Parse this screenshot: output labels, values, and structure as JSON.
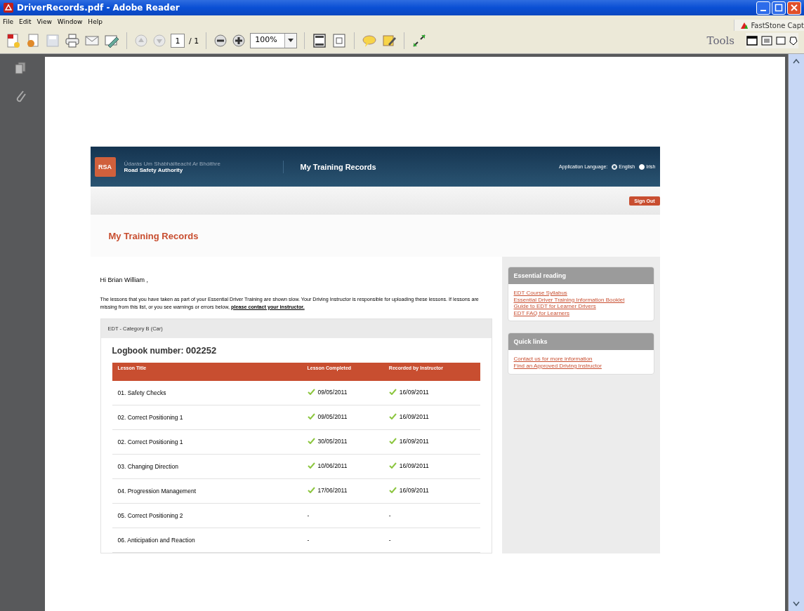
{
  "window": {
    "title": "DriverRecords.pdf - Adobe Reader"
  },
  "menu": [
    "File",
    "Edit",
    "View",
    "Window",
    "Help"
  ],
  "toolbar": {
    "page_number": "1",
    "page_total": "/ 1",
    "zoom": "100%",
    "tools": "Tools"
  },
  "capture_bar": {
    "title": "FastStone Capt"
  },
  "site": {
    "logo": "RSA",
    "org_irish": "Údarás Um Shábháilteacht Ar Bhóithre",
    "org_english": "Road Safety Authority",
    "header_title": "My Training Records",
    "language_label": "Application Language:",
    "languages": [
      {
        "label": "English",
        "selected": true
      },
      {
        "label": "Irish",
        "selected": false
      }
    ],
    "sign_out": "Sign Out",
    "page_title": "My Training Records"
  },
  "greeting": "Hi Brian William ,",
  "intro": "The lessons that you have taken as part of your Essential Driver Training are shown slow. Your Driving Instructor is responsible for uploading these lessons. If lessons are missing from this list, or you see warnings or errors below,",
  "intro_link": "please contact your instructor.",
  "category": "EDT - Category B (Car)",
  "logbook_label": "Logbook number:",
  "logbook_number": "002252",
  "table": {
    "columns": [
      "Lesson Title",
      "Lesson Completed",
      "Recorded by Instructor"
    ],
    "rows": [
      {
        "title": "01. Safety Checks",
        "completed": "09/05/2011",
        "recorded": "16/09/2011",
        "done": true
      },
      {
        "title": "02. Correct Positioning 1",
        "completed": "09/05/2011",
        "recorded": "16/09/2011",
        "done": true
      },
      {
        "title": "02. Correct Positioning 1",
        "completed": "30/05/2011",
        "recorded": "16/09/2011",
        "done": true
      },
      {
        "title": "03. Changing Direction",
        "completed": "10/06/2011",
        "recorded": "16/09/2011",
        "done": true
      },
      {
        "title": "04. Progression Management",
        "completed": "17/06/2011",
        "recorded": "16/09/2011",
        "done": true
      },
      {
        "title": "05. Correct Positioning 2",
        "completed": "-",
        "recorded": "-",
        "done": false
      },
      {
        "title": "06. Anticipation and Reaction",
        "completed": "-",
        "recorded": "-",
        "done": false
      }
    ]
  },
  "sidebar": [
    {
      "heading": "Essential reading",
      "links": [
        "EDT Course Syllabus",
        "Essential Driver Training Information Booklet",
        "Guide to EDT for Learner Drivers",
        "EDT FAQ for Learners"
      ]
    },
    {
      "heading": "Quick links",
      "links": [
        "Contact us for more information",
        "Find an Approved Driving Instructor"
      ]
    }
  ]
}
